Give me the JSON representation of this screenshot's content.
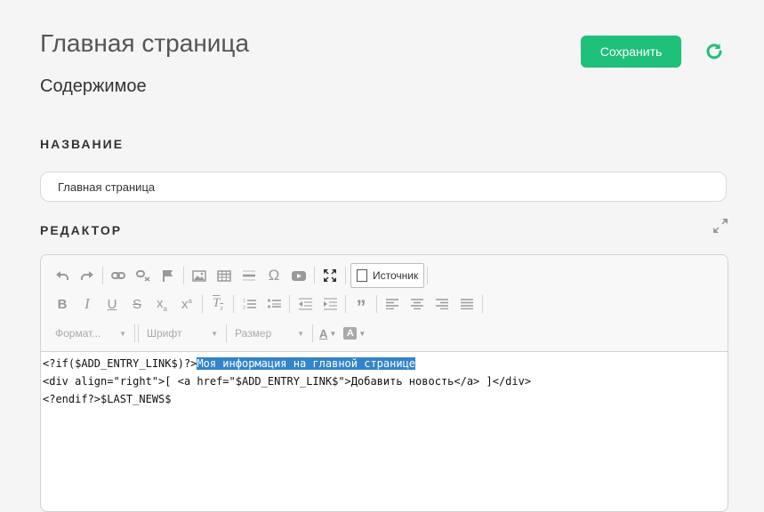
{
  "header": {
    "title": "Главная страница",
    "subtitle": "Содержимое",
    "save_label": "Сохранить"
  },
  "form": {
    "name_label": "НАЗВАНИЕ",
    "name_value": "Главная страница",
    "editor_label": "РЕДАКТОР"
  },
  "toolbar": {
    "source_label": "Источник",
    "format_label": "Формат...",
    "font_label": "Шрифт",
    "size_label": "Размер"
  },
  "editor": {
    "line1_code": "<?if($ADD_ENTRY_LINK$)?>",
    "line1_selected": "Моя информация на главной странице",
    "line2": "<div align=\"right\">[ <a href=\"$ADD_ENTRY_LINK$\">Добавить новость</a> ]</div>",
    "line3": "<?endif?>$LAST_NEWS$"
  },
  "colors": {
    "accent": "#1ec07a",
    "selection": "#3484c9"
  }
}
